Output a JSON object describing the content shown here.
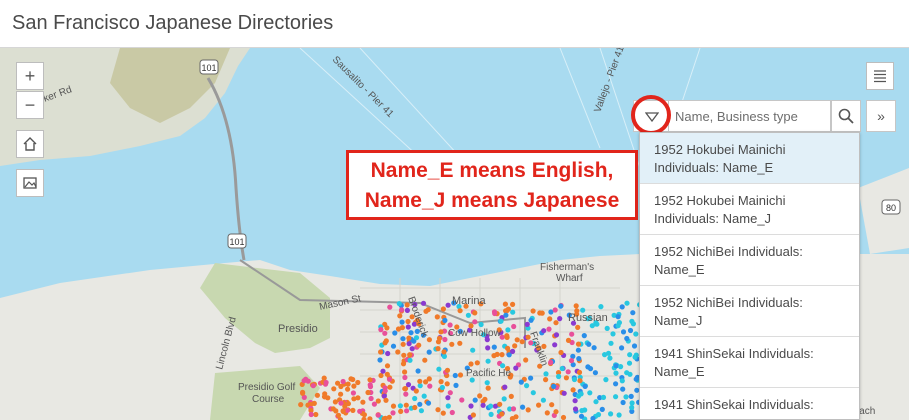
{
  "app": {
    "title": "San Francisco Japanese Directories"
  },
  "map_controls": {
    "zoom_in_label": "+",
    "zoom_out_label": "−",
    "home_icon": "home-icon",
    "basemap_icon": "basemap-gallery-icon",
    "layer_list_icon": "layer-list-icon",
    "expand_label": "»"
  },
  "search": {
    "placeholder": "Name, Business type",
    "value": "",
    "source_toggle_icon": "triangle-down-icon",
    "search_icon": "search-icon"
  },
  "callout": {
    "line1": "Name_E means English,",
    "line2": "Name_J means Japanese"
  },
  "dropdown": {
    "options": [
      {
        "label": "1952 Hokubei Mainichi Individuals: Name_E"
      },
      {
        "label": "1952 Hokubei Mainichi Individuals: Name_J"
      },
      {
        "label": "1952 NichiBei Individuals: Name_E"
      },
      {
        "label": "1952 NichiBei Individuals: Name_J"
      },
      {
        "label": "1941 ShinSekai Individuals: Name_E"
      },
      {
        "label": "1941 ShinSekai Individuals:"
      }
    ]
  },
  "map_labels": {
    "bunker_rd": "Bunker Rd",
    "sausalito": "Sausalito - Pier 41",
    "vallejo": "Vallejo - Pier 41",
    "fishermans_wharf_1": "Fisherman's",
    "fishermans_wharf_2": "Wharf",
    "marina": "Marina",
    "mason_st": "Mason St",
    "presidio": "Presidio",
    "broderick": "Broderick",
    "lincoln_blvd": "Lincoln Blvd",
    "cow_hollow": "Cow Hollow",
    "pacific_heights": "Pacific He",
    "russian_hill": "Russian",
    "presidio_golf_1": "Presidio Golf",
    "presidio_golf_2": "Course",
    "franklin": "Franklin",
    "south_beach": "South Beach",
    "hwy_101_a": "101",
    "hwy_101_b": "101",
    "hwy_80": "80"
  },
  "colors": {
    "water": "#a9dbf0",
    "land": "#e8e8e3",
    "park": "#c8d8b0",
    "accent_red": "#e1251b",
    "dot_orange": "#f07a2a",
    "dot_blue": "#2a8ee8",
    "dot_cyan": "#28c8e0",
    "dot_purple": "#8a3ad0",
    "dot_pink": "#e8509a"
  }
}
